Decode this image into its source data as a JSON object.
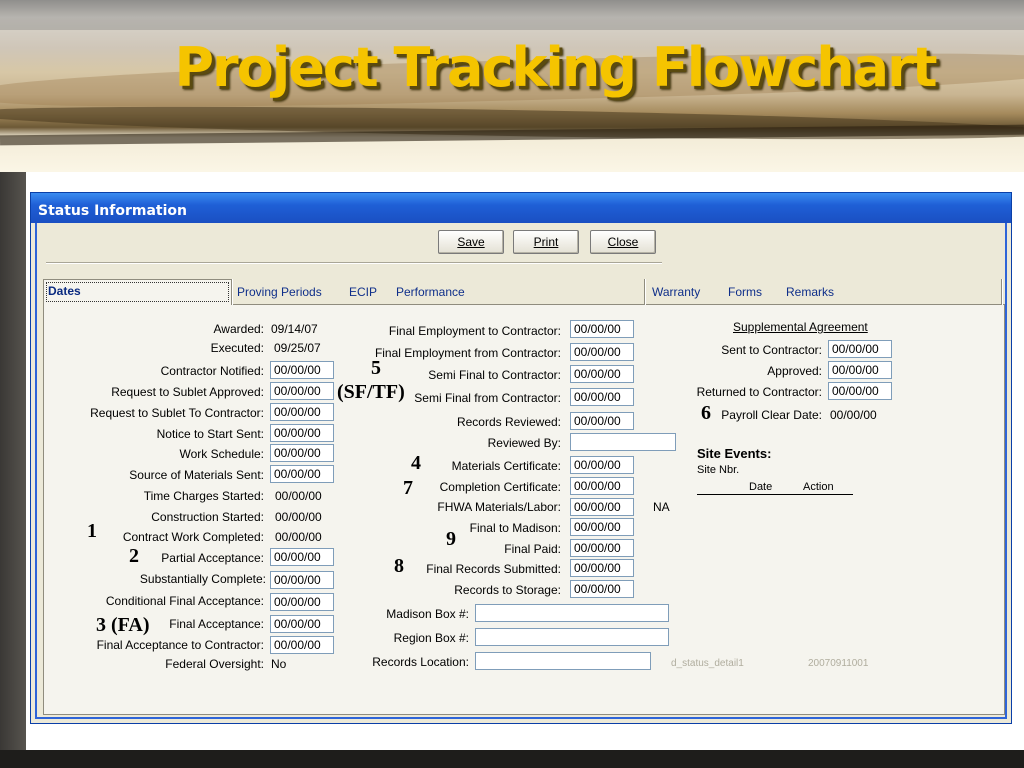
{
  "slide": {
    "title": "Project Tracking Flowchart"
  },
  "window": {
    "title": "Status Information"
  },
  "toolbar": {
    "save_label": "Save",
    "print_label": "Print",
    "close_label": "Close"
  },
  "tabs": {
    "dates": "Dates",
    "proving_periods": "Proving Periods",
    "ecip": "ECIP",
    "performance": "Performance",
    "warranty": "Warranty",
    "forms": "Forms",
    "remarks": "Remarks"
  },
  "left": {
    "awarded_label": "Awarded:",
    "awarded_value": "09/14/07",
    "executed_label": "Executed:",
    "executed_value": "09/25/07",
    "contractor_notified_label": "Contractor Notified:",
    "contractor_notified_value": "00/00/00",
    "sublet_approved_label": "Request to Sublet Approved:",
    "sublet_approved_value": "00/00/00",
    "sublet_to_contractor_label": "Request to Sublet To Contractor:",
    "sublet_to_contractor_value": "00/00/00",
    "notice_to_start_label": "Notice to Start Sent:",
    "notice_to_start_value": "00/00/00",
    "work_schedule_label": "Work Schedule:",
    "work_schedule_value": "00/00/00",
    "source_materials_label": "Source of Materials Sent:",
    "source_materials_value": "00/00/00",
    "time_charges_label": "Time Charges Started:",
    "time_charges_value": "00/00/00",
    "construction_started_label": "Construction Started:",
    "construction_started_value": "00/00/00",
    "contract_work_label": "Contract Work Completed:",
    "contract_work_value": "00/00/00",
    "partial_acceptance_label": "Partial Acceptance:",
    "partial_acceptance_value": "00/00/00",
    "substantially_complete_label": "Substantially Complete:",
    "substantially_complete_value": "00/00/00",
    "conditional_final_label": "Conditional Final Acceptance:",
    "conditional_final_value": "00/00/00",
    "final_acceptance_label": "Final Acceptance:",
    "final_acceptance_value": "00/00/00",
    "final_to_contractor_label": "Final Acceptance to Contractor:",
    "final_to_contractor_value": "00/00/00",
    "federal_oversight_label": "Federal Oversight:",
    "federal_oversight_value": "No"
  },
  "middle": {
    "final_emp_to_label": "Final Employment to Contractor:",
    "final_emp_to_value": "00/00/00",
    "final_emp_from_label": "Final Employment from Contractor:",
    "final_emp_from_value": "00/00/00",
    "semi_final_to_label": "Semi Final to Contractor:",
    "semi_final_to_value": "00/00/00",
    "semi_final_from_label": "Semi Final from Contractor:",
    "semi_final_from_value": "00/00/00",
    "records_reviewed_label": "Records Reviewed:",
    "records_reviewed_value": "00/00/00",
    "reviewed_by_label": "Reviewed By:",
    "reviewed_by_value": "",
    "materials_cert_label": "Materials Certificate:",
    "materials_cert_value": "00/00/00",
    "completion_cert_label": "Completion Certificate:",
    "completion_cert_value": "00/00/00",
    "fhwa_label": "FHWA Materials/Labor:",
    "fhwa_value": "00/00/00",
    "fhwa_na": "NA",
    "final_madison_label": "Final to Madison:",
    "final_madison_value": "00/00/00",
    "final_paid_label": "Final Paid:",
    "final_paid_value": "00/00/00",
    "final_records_label": "Final Records Submitted:",
    "final_records_value": "00/00/00",
    "records_storage_label": "Records to Storage:",
    "records_storage_value": "00/00/00",
    "madison_box_label": "Madison Box #:",
    "madison_box_value": "",
    "region_box_label": "Region Box #:",
    "region_box_value": "",
    "records_location_label": "Records Location:",
    "records_location_value": ""
  },
  "right": {
    "supplemental_heading": "Supplemental Agreement",
    "sent_label": "Sent to Contractor:",
    "sent_value": "00/00/00",
    "approved_label": "Approved:",
    "approved_value": "00/00/00",
    "returned_label": "Returned to Contractor:",
    "returned_value": "00/00/00",
    "payroll_label": "Payroll Clear Date:",
    "payroll_value": "00/00/00",
    "site_events_heading": "Site Events:",
    "site_nbr_label": "Site Nbr.",
    "col_date": "Date",
    "col_action": "Action"
  },
  "footer": {
    "detail_id": "d_status_detail1",
    "stamp": "20070911001"
  },
  "markers": {
    "m1": "1",
    "m2": "2",
    "m3": "3 (FA)",
    "m4": "4",
    "m5": "5",
    "m5b": "(SF/TF)",
    "m6": "6",
    "m7": "7",
    "m8": "8",
    "m9": "9"
  },
  "colors": {
    "title": "#f5c400",
    "titlebar": "#1f5fd6",
    "tab_text": "#0f2f8a"
  }
}
